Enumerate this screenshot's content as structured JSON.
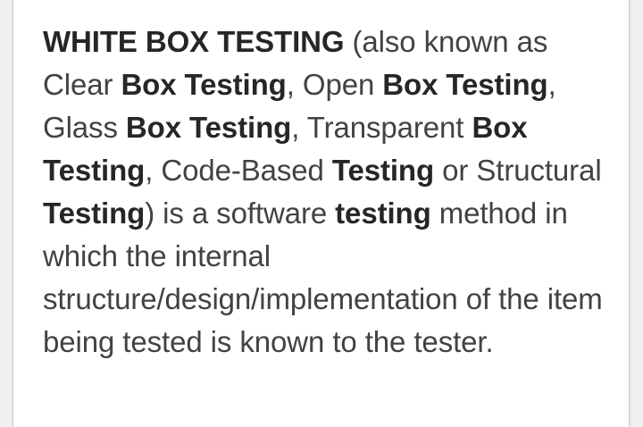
{
  "article": {
    "segments": [
      {
        "text": "WHITE BOX TESTING",
        "bold": true
      },
      {
        "text": " (also known as Clear ",
        "bold": false
      },
      {
        "text": "Box Testing",
        "bold": true
      },
      {
        "text": ", Open ",
        "bold": false
      },
      {
        "text": "Box Testing",
        "bold": true
      },
      {
        "text": ", Glass ",
        "bold": false
      },
      {
        "text": "Box Testing",
        "bold": true
      },
      {
        "text": ", Transparent ",
        "bold": false
      },
      {
        "text": "Box Testing",
        "bold": true
      },
      {
        "text": ", Code-Based ",
        "bold": false
      },
      {
        "text": "Testing",
        "bold": true
      },
      {
        "text": " or Structural ",
        "bold": false
      },
      {
        "text": "Testing",
        "bold": true
      },
      {
        "text": ") is a software ",
        "bold": false
      },
      {
        "text": "testing",
        "bold": true
      },
      {
        "text": " method in which the internal structure/design/implementation of the item being tested is known to the tester.",
        "bold": false
      }
    ]
  }
}
